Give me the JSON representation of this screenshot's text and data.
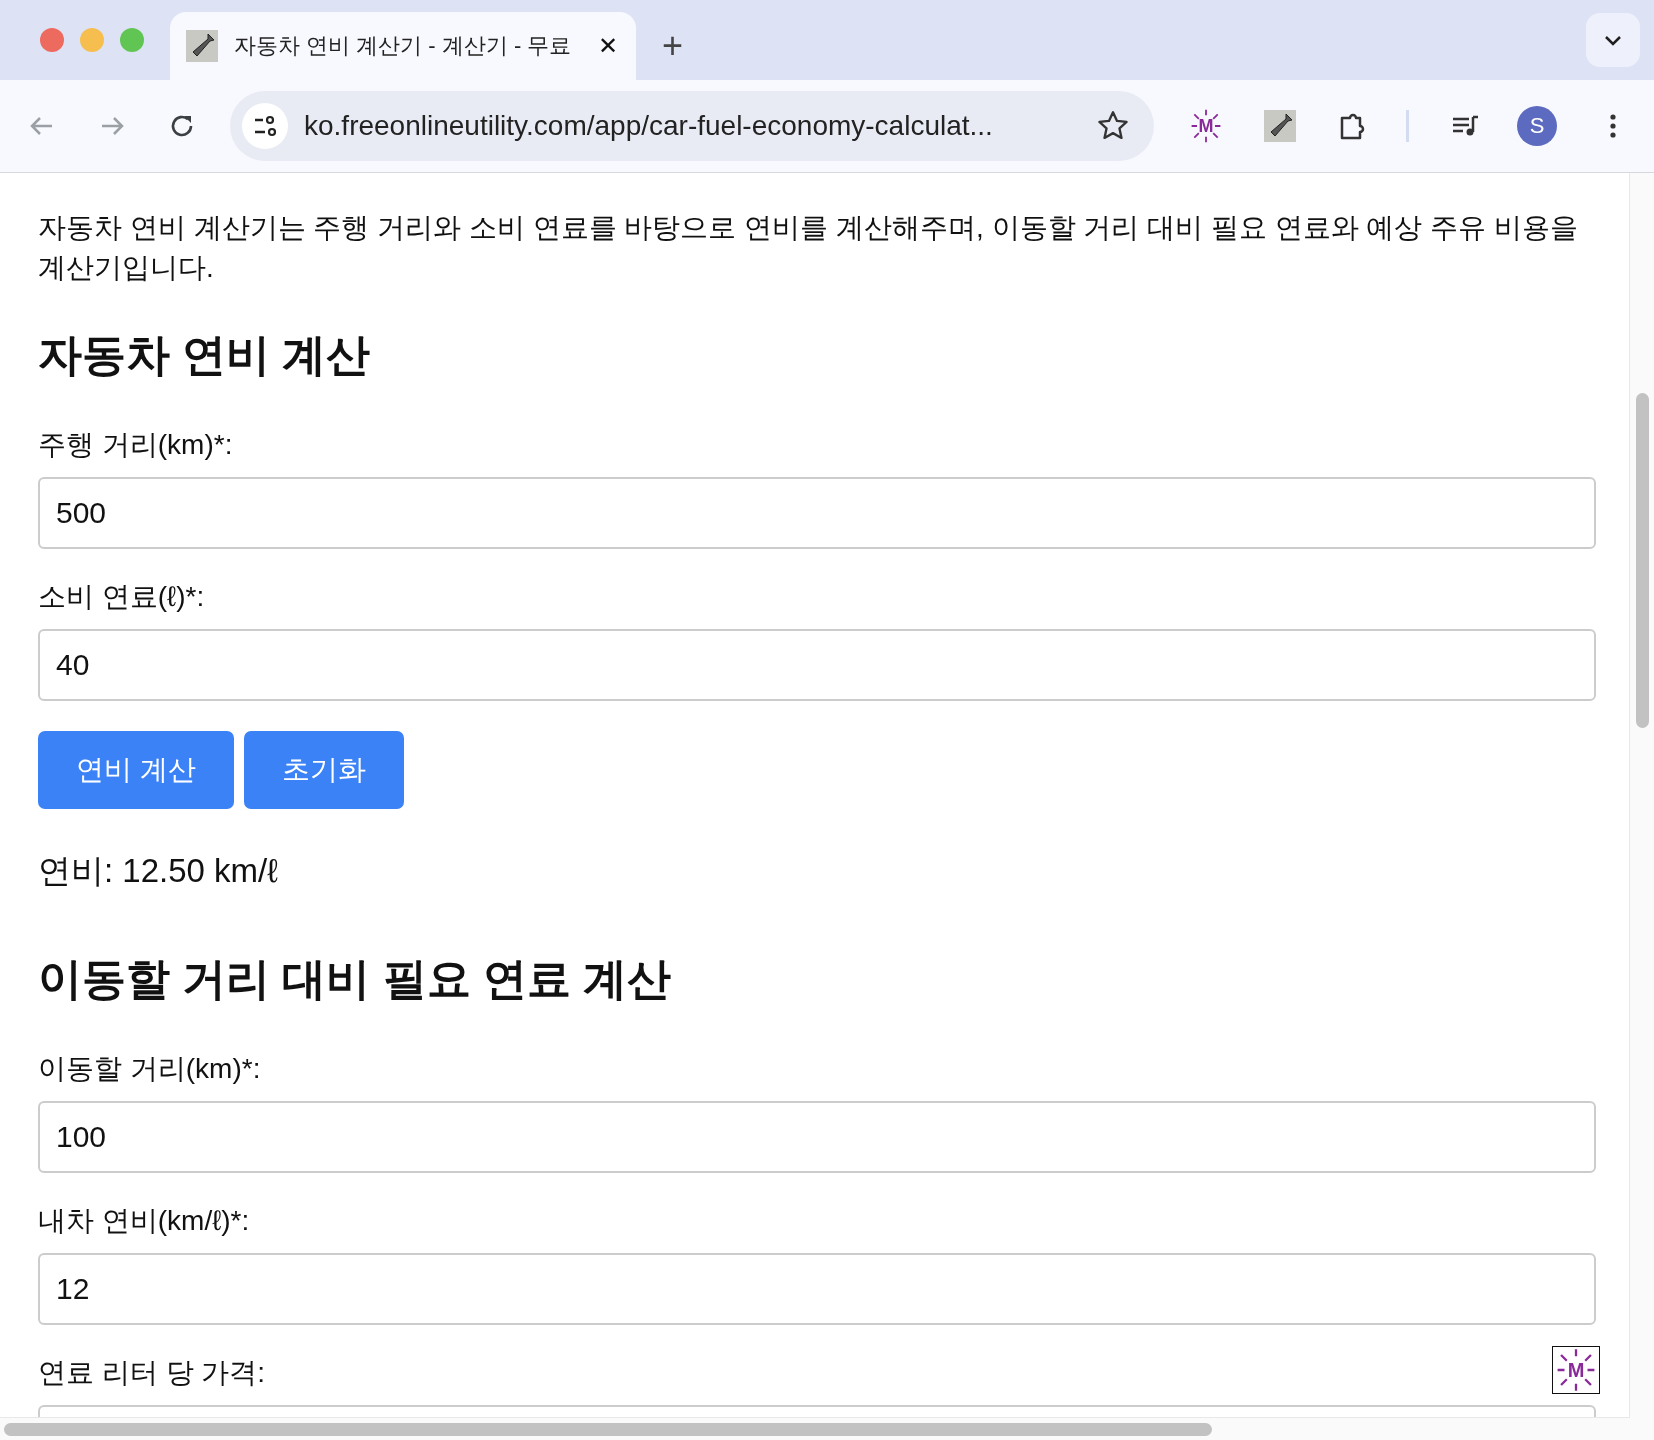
{
  "browser": {
    "tab": {
      "title": "자동차 연비 계산기 - 계산기 - 무료",
      "close": "✕",
      "selected": true
    },
    "new_tab": "+",
    "url": "ko.freeonlineutility.com/app/car-fuel-economy-calculat...",
    "extension_label": "M",
    "profile_initial": "S"
  },
  "page": {
    "intro": "자동차 연비 계산기는 주행 거리와 소비 연료를 바탕으로 연비를 계산해주며, 이동할 거리 대비 필요 연료와 예상 주유 비용을 계산기입니다.",
    "sections": [
      {
        "title": "자동차 연비 계산",
        "fields": [
          {
            "label": "주행 거리(km)*:",
            "value": "500"
          },
          {
            "label": "소비 연료(ℓ)*:",
            "value": "40"
          }
        ],
        "buttons": [
          "연비 계산",
          "초기화"
        ],
        "result": "연비: 12.50 km/ℓ"
      },
      {
        "title": "이동할 거리 대비 필요 연료 계산",
        "fields": [
          {
            "label": "이동할 거리(km)*:",
            "value": "100"
          },
          {
            "label": "내차 연비(km/ℓ)*:",
            "value": "12"
          },
          {
            "label": "연료 리터 당 가격:"
          }
        ]
      }
    ]
  },
  "floating_badge": "M"
}
